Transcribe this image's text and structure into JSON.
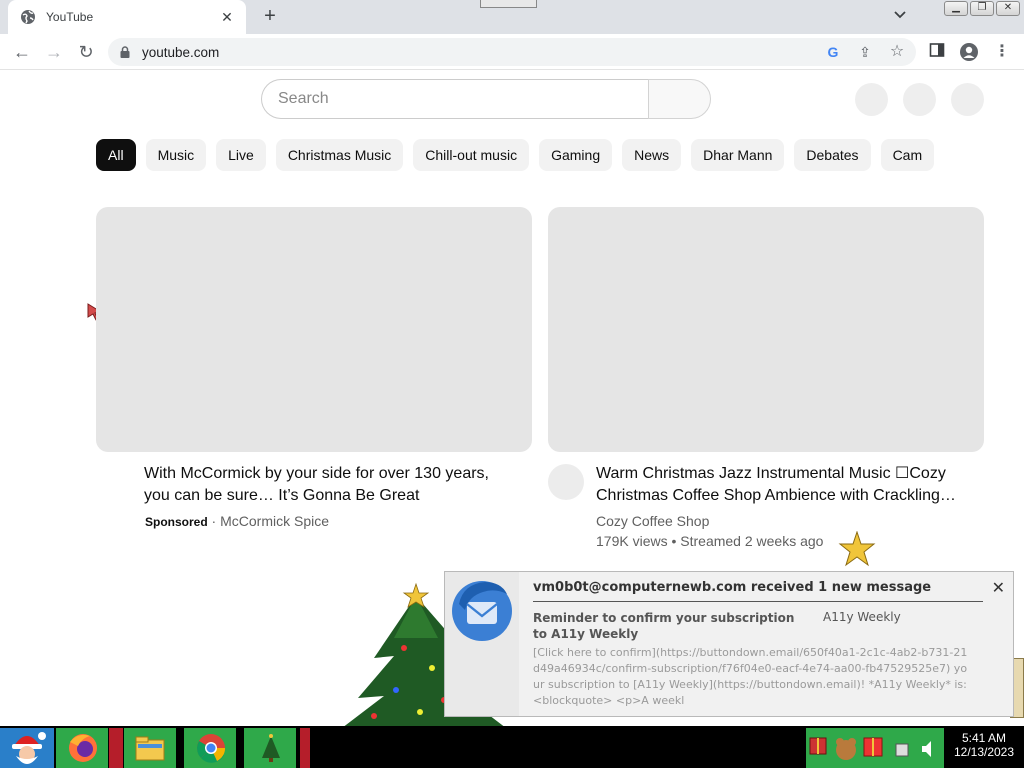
{
  "browser": {
    "tab_title": "YouTube",
    "tab_close": "✕",
    "new_tab": "+",
    "tab_search": "⌄",
    "window_buttons": [
      "▁",
      "❐",
      "✕"
    ],
    "url": "youtube.com",
    "nav": {
      "back": "←",
      "forward": "→",
      "reload": "↻"
    },
    "omni_icons": {
      "google": "G",
      "share": "⇪",
      "bookmark": "☆"
    },
    "toolbar_icons": {
      "side_panel": "▥",
      "profile": "●",
      "menu": "⋮"
    }
  },
  "youtube": {
    "search_placeholder": "Search",
    "chips": [
      "All",
      "Music",
      "Live",
      "Christmas Music",
      "Chill-out music",
      "Gaming",
      "News",
      "Dhar Mann",
      "Debates",
      "Cam"
    ],
    "active_chip": "All",
    "videos": [
      {
        "title": "With McCormick by your side for over 130 years, you can be sure… It’s Gonna Be Great",
        "sponsored_label": "Sponsored",
        "separator": " · ",
        "channel": "McCormick Spice"
      },
      {
        "title": "Warm Christmas Jazz Instrumental Music ☐Cozy Christmas Coffee Shop Ambience with Crackling…",
        "channel": "Cozy Coffee Shop",
        "stats": "179K views • Streamed 2 weeks ago"
      }
    ]
  },
  "notification": {
    "header": "vm0b0t@computernewb.com received 1 new message",
    "close": "✕",
    "subject": "Reminder to confirm your subscription to A11y Weekly",
    "from": "A11y Weekly",
    "body": "[Click here to confirm](https://buttondown.email/650f40a1-2c1c-4ab2-b731-21d49a46934c/confirm-subscription/f76f04e0-eacf-4e74-aa00-fb47529525e7) your subscription to [A11y Weekly](https://buttondown.email)! *A11y Weekly* is: <blockquote> <p>A weekl"
  },
  "taskbar": {
    "time": "5:41 AM",
    "date": "12/13/2023"
  },
  "colors": {
    "chip_active_bg": "#0f0f0f",
    "taskbar_green": "#2fa94a",
    "taskbar_red": "#b51e2a"
  }
}
